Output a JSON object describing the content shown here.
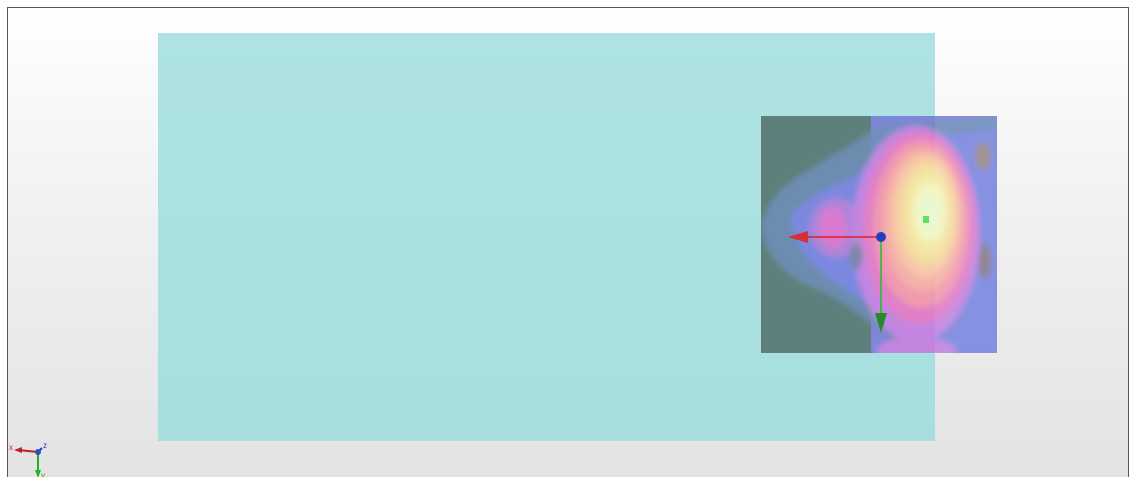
{
  "viewport": {
    "label": "3d-viewport"
  },
  "scene": {
    "plane_color": "#aadfdf",
    "field_palette": [
      "#5f7f7c",
      "#6f86d8",
      "#8f8cf0",
      "#d97ad0",
      "#f09ab0",
      "#f8c8b0",
      "#f4e8a8",
      "#f2f6c4",
      "#e8f8d0"
    ]
  },
  "gizmo": {
    "x_axis_color": "#e02020",
    "y_axis_color": "#20c020",
    "center_color": "#2040c0"
  },
  "triad": {
    "x_label": "x",
    "y_label": "y",
    "z_label": "z"
  },
  "icons": {
    "move_gizmo": "translate-gizmo-icon",
    "axis_triad": "axis-orientation-icon"
  }
}
